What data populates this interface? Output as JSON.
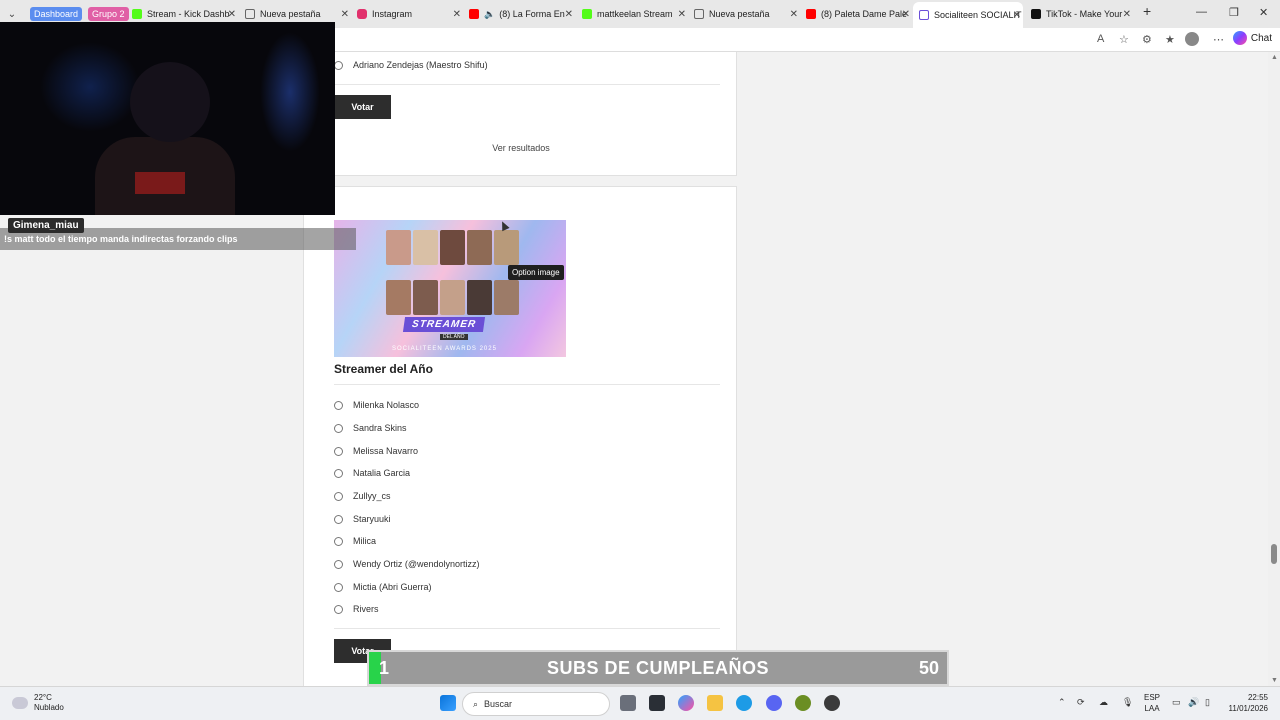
{
  "browser": {
    "tab_groups": [
      "Dashboard",
      "Grupo 2"
    ],
    "tabs": [
      {
        "title": "Stream - Kick Dashb",
        "color": "#53fc18"
      },
      {
        "title": "Nueva pestaña",
        "color": "#888888"
      },
      {
        "title": "Instagram",
        "color": "#e1306c"
      },
      {
        "title": "(8) La Forma En",
        "color": "#ff0000"
      },
      {
        "title": "mattkeelan Stream",
        "color": "#53fc18"
      },
      {
        "title": "Nueva pestaña",
        "color": "#888888"
      },
      {
        "title": "(8) Paleta Dame Pale",
        "color": "#ff0000"
      },
      {
        "title": "Socialiteen SOCIALIT",
        "color": "#6b4fd8"
      },
      {
        "title": "TikTok - Make Your",
        "color": "#111111"
      }
    ],
    "new_tab": "+",
    "chat_label": "Chat"
  },
  "poll_prev": {
    "last_option": "Adriano Zendejas (Maestro Shifu)",
    "vote_label": "Votar",
    "results_label": "Ver resultados"
  },
  "poll": {
    "image_title": "STREAMER",
    "image_subtitle": "DEL AÑO",
    "image_footer": "SOCIALITEEN AWARDS 2025",
    "tooltip": "Option image",
    "title": "Streamer del Año",
    "options": [
      "Milenka Nolasco",
      "Sandra Skins",
      "Melissa Navarro",
      "Natalia Garcia",
      "Zullyy_cs",
      "Staryuuki",
      "Milica",
      "Wendy Ortiz (@wendolynortizz)",
      "Mictia (Abri Guerra)",
      "Rivers"
    ],
    "vote_label": "Votar"
  },
  "stream_overlay": {
    "chat_user": "Gimena_miau",
    "chat_message": "!s matt todo el tiempo manda indirectas forzando clips",
    "goal_current": "1",
    "goal_label": "SUBS DE CUMPLEAÑOS",
    "goal_max": "50",
    "goal_progress": 0.02
  },
  "taskbar": {
    "temp": "22°C",
    "weather": "Nublado",
    "search_placeholder": "Buscar",
    "lang_1": "ESP",
    "lang_2": "LAA",
    "time": "22:55",
    "date": "11/01/2026"
  }
}
